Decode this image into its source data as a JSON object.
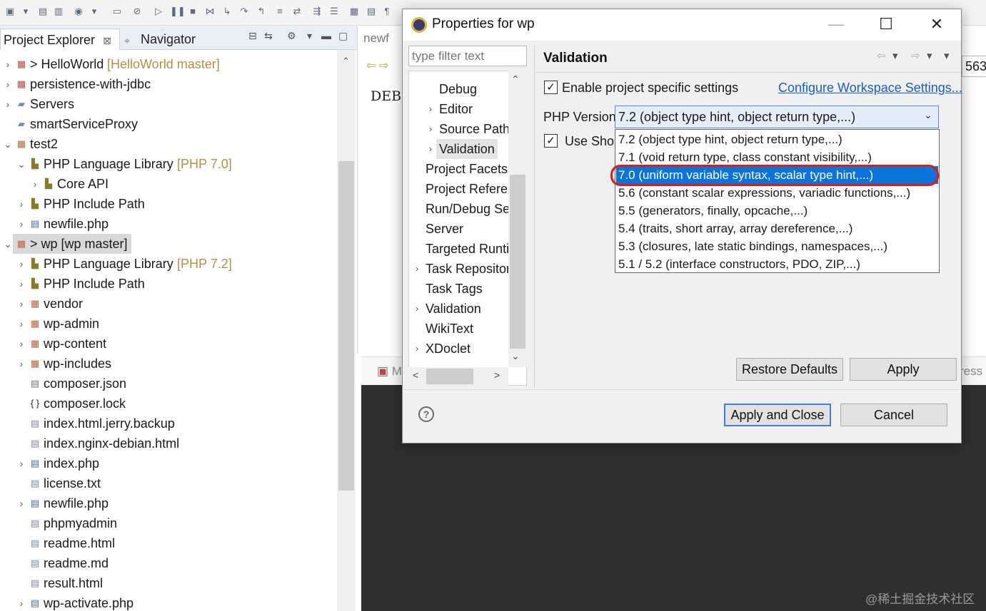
{
  "toolbar": {
    "icons": [
      "new-icon",
      "save-icon",
      "save-all-icon",
      "profile-icon",
      "console-icon",
      "debug-skip-icon",
      "resume-icon",
      "suspend-icon",
      "terminate-icon",
      "disconnect-icon",
      "step-into-icon",
      "step-over-icon",
      "step-return-icon",
      "drop-frame-icon",
      "use-step-filters-icon",
      "run-icon",
      "debug-icon",
      "external-tools-icon"
    ]
  },
  "project_explorer": {
    "tab_label": "Project Explorer",
    "tab_close": "⊠",
    "navigator_tab_label": "Navigator",
    "tree": [
      {
        "label": "> HelloWorld",
        "decoration": "[HelloWorld master]",
        "icon": "git-project-icon",
        "arrow": "›",
        "depth": 0
      },
      {
        "label": "persistence-with-jdbc",
        "decoration": "",
        "icon": "git-project-icon",
        "arrow": "›",
        "depth": 0
      },
      {
        "label": "Servers",
        "decoration": "",
        "icon": "folder-icon",
        "arrow": "›",
        "depth": 0
      },
      {
        "label": "smartServiceProxy",
        "decoration": "",
        "icon": "folder-icon",
        "arrow": "",
        "depth": 0
      },
      {
        "label": "test2",
        "decoration": "",
        "icon": "php-project-icon",
        "arrow": "⌄",
        "depth": 0
      },
      {
        "label": "PHP Language Library",
        "decoration": "[PHP 7.0]",
        "icon": "library-icon",
        "arrow": "⌄",
        "depth": 1
      },
      {
        "label": "Core API",
        "decoration": "",
        "icon": "library-icon",
        "arrow": "›",
        "depth": 2
      },
      {
        "label": "PHP Include Path",
        "decoration": "",
        "icon": "library-icon",
        "arrow": "›",
        "depth": 1
      },
      {
        "label": "newfile.php",
        "decoration": "",
        "icon": "php-file-icon",
        "arrow": "›",
        "depth": 1
      },
      {
        "label": "> wp [wp master]",
        "decoration": "",
        "icon": "php-project-icon",
        "arrow": "⌄",
        "depth": 0,
        "selected": true
      },
      {
        "label": "PHP Language Library",
        "decoration": "[PHP 7.2]",
        "icon": "library-icon",
        "arrow": "›",
        "depth": 1
      },
      {
        "label": "PHP Include Path",
        "decoration": "",
        "icon": "library-icon",
        "arrow": "›",
        "depth": 1
      },
      {
        "label": "vendor",
        "decoration": "",
        "icon": "package-folder-icon",
        "arrow": "›",
        "depth": 1
      },
      {
        "label": "wp-admin",
        "decoration": "",
        "icon": "package-folder-icon",
        "arrow": "›",
        "depth": 1
      },
      {
        "label": "wp-content",
        "decoration": "",
        "icon": "package-folder-icon",
        "arrow": "›",
        "depth": 1
      },
      {
        "label": "wp-includes",
        "decoration": "",
        "icon": "package-folder-icon",
        "arrow": "›",
        "depth": 1
      },
      {
        "label": "composer.json",
        "decoration": "",
        "icon": "json-file-icon",
        "arrow": "",
        "depth": 1
      },
      {
        "label": "composer.lock",
        "decoration": "",
        "icon": "braces-file-icon",
        "arrow": "",
        "depth": 1
      },
      {
        "label": "index.html.jerry.backup",
        "decoration": "",
        "icon": "text-file-icon",
        "arrow": "",
        "depth": 1
      },
      {
        "label": "index.nginx-debian.html",
        "decoration": "",
        "icon": "text-file-icon",
        "arrow": "",
        "depth": 1
      },
      {
        "label": "index.php",
        "decoration": "",
        "icon": "php-file-icon",
        "arrow": "›",
        "depth": 1
      },
      {
        "label": "license.txt",
        "decoration": "",
        "icon": "text-file-icon",
        "arrow": "",
        "depth": 1
      },
      {
        "label": "newfile.php",
        "decoration": "",
        "icon": "php-file-icon",
        "arrow": "›",
        "depth": 1
      },
      {
        "label": "phpmyadmin",
        "decoration": "",
        "icon": "text-file-icon",
        "arrow": "",
        "depth": 1
      },
      {
        "label": "readme.html",
        "decoration": "",
        "icon": "text-file-icon",
        "arrow": "",
        "depth": 1
      },
      {
        "label": "readme.md",
        "decoration": "",
        "icon": "text-file-icon",
        "arrow": "",
        "depth": 1
      },
      {
        "label": "result.html",
        "decoration": "",
        "icon": "text-file-icon",
        "arrow": "",
        "depth": 1
      },
      {
        "label": "wp-activate.php",
        "decoration": "",
        "icon": "php-file-icon",
        "arrow": "›",
        "depth": 1
      }
    ]
  },
  "editor": {
    "tab_label": "newf",
    "text": "DEBU",
    "number": "563"
  },
  "bottom_panel": {
    "markers_label": "Mark",
    "progress_label": "ress"
  },
  "dialog": {
    "title": "Properties for wp",
    "window_controls": {
      "minimize": "—",
      "maximize": "☐",
      "close": "✕"
    },
    "filter_placeholder": "type filter text",
    "nav_tree": [
      {
        "label": "Debug",
        "arrow": "",
        "indent": 1
      },
      {
        "label": "Editor",
        "arrow": "›",
        "indent": 1
      },
      {
        "label": "Source Paths",
        "arrow": "›",
        "indent": 1
      },
      {
        "label": "Validation",
        "arrow": "›",
        "indent": 1,
        "selected": true
      },
      {
        "label": "Project Facets",
        "arrow": "",
        "indent": 0
      },
      {
        "label": "Project References",
        "arrow": "",
        "indent": 0
      },
      {
        "label": "Run/Debug Settings",
        "arrow": "",
        "indent": 0
      },
      {
        "label": "Server",
        "arrow": "",
        "indent": 0
      },
      {
        "label": "Targeted Runtimes",
        "arrow": "",
        "indent": 0
      },
      {
        "label": "Task Repository",
        "arrow": "›",
        "indent": 0
      },
      {
        "label": "Task Tags",
        "arrow": "",
        "indent": 0
      },
      {
        "label": "Validation",
        "arrow": "›",
        "indent": 0
      },
      {
        "label": "WikiText",
        "arrow": "",
        "indent": 0
      },
      {
        "label": "XDoclet",
        "arrow": "›",
        "indent": 0
      }
    ],
    "page_title": "Validation",
    "enable_specific": "Enable project specific settings",
    "enable_specific_checked": true,
    "configure_link": "Configure Workspace Settings...",
    "php_version_label": "PHP Version:",
    "php_version_value": "7.2 (object type hint, object return type,...)",
    "use_short_label": "Use Shor",
    "use_short_checked": true,
    "version_options": [
      "7.2 (object type hint, object return type,...)",
      "7.1 (void return type, class constant visibility,...)",
      "7.0 (uniform variable syntax, scalar type hint,...)",
      "5.6 (constant scalar expressions, variadic functions,...)",
      "5.5 (generators, finally, opcache,...)",
      "5.4 (traits, short array, array dereference,...)",
      "5.3 (closures, late static bindings, namespaces,...)",
      "5.1 / 5.2 (interface constructors, PDO, ZIP,...)"
    ],
    "highlighted_option_index": 2,
    "restore_defaults": "Restore Defaults",
    "apply": "Apply",
    "apply_and_close": "Apply and Close",
    "cancel": "Cancel",
    "help": "?"
  },
  "watermark": "@稀土掘金技术社区",
  "colors": {
    "selection_blue": "#0a74da",
    "annotation_red": "#e01a1a",
    "link_blue": "#1a5ec7",
    "decoration_gold": "#b38f44"
  }
}
